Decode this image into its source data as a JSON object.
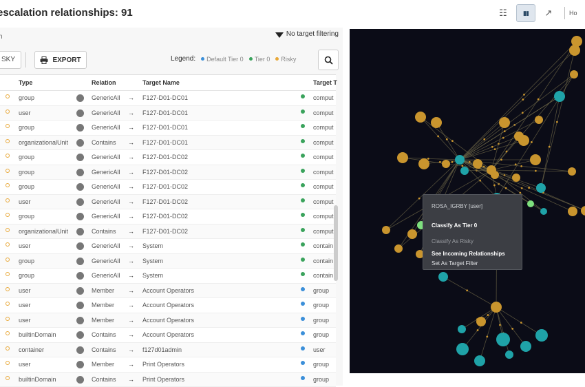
{
  "header": {
    "title": "escalation relationships: 91",
    "view_buttons": [
      {
        "icon": "list-view-icon",
        "glyph": "☷"
      },
      {
        "icon": "split-view-icon",
        "glyph": "▮▮"
      },
      {
        "icon": "graph-view-icon",
        "glyph": "↗"
      }
    ],
    "cut_label": "Ho"
  },
  "panel": {
    "subtitle": "n",
    "filter_label": "No target filtering"
  },
  "toolbar": {
    "risky_label": "SKY",
    "export_label": "EXPORT",
    "legend_label": "Legend:",
    "legend": [
      {
        "label": "Default Tier 0",
        "color": "#3b8fd9"
      },
      {
        "label": "Tier 0",
        "color": "#3aa35c"
      },
      {
        "label": "Risky",
        "color": "#e8a838"
      }
    ]
  },
  "table": {
    "columns": [
      "Type",
      "Relation",
      "Target Name",
      "Target T"
    ],
    "rows": [
      {
        "type": "group",
        "relation": "GenericAll",
        "target": "F127-D01-DC01",
        "ttype": "comput",
        "tcolor": "#3aa35c"
      },
      {
        "type": "user",
        "relation": "GenericAll",
        "target": "F127-D01-DC01",
        "ttype": "comput",
        "tcolor": "#3aa35c"
      },
      {
        "type": "group",
        "relation": "GenericAll",
        "target": "F127-D01-DC01",
        "ttype": "comput",
        "tcolor": "#3aa35c"
      },
      {
        "type": "organizationalUnit",
        "relation": "Contains",
        "target": "F127-D01-DC01",
        "ttype": "comput",
        "tcolor": "#3aa35c"
      },
      {
        "type": "group",
        "relation": "GenericAll",
        "target": "F127-D01-DC02",
        "ttype": "comput",
        "tcolor": "#3aa35c"
      },
      {
        "type": "group",
        "relation": "GenericAll",
        "target": "F127-D01-DC02",
        "ttype": "comput",
        "tcolor": "#3aa35c"
      },
      {
        "type": "group",
        "relation": "GenericAll",
        "target": "F127-D01-DC02",
        "ttype": "comput",
        "tcolor": "#3aa35c"
      },
      {
        "type": "user",
        "relation": "GenericAll",
        "target": "F127-D01-DC02",
        "ttype": "comput",
        "tcolor": "#3aa35c"
      },
      {
        "type": "group",
        "relation": "GenericAll",
        "target": "F127-D01-DC02",
        "ttype": "comput",
        "tcolor": "#3aa35c"
      },
      {
        "type": "organizationalUnit",
        "relation": "Contains",
        "target": "F127-D01-DC02",
        "ttype": "comput",
        "tcolor": "#3aa35c"
      },
      {
        "type": "user",
        "relation": "GenericAll",
        "target": "System",
        "ttype": "contain",
        "tcolor": "#3aa35c"
      },
      {
        "type": "group",
        "relation": "GenericAll",
        "target": "System",
        "ttype": "contain",
        "tcolor": "#3aa35c"
      },
      {
        "type": "group",
        "relation": "GenericAll",
        "target": "System",
        "ttype": "contain",
        "tcolor": "#3aa35c"
      },
      {
        "type": "user",
        "relation": "Member",
        "target": "Account Operators",
        "ttype": "group",
        "tcolor": "#3b8fd9"
      },
      {
        "type": "user",
        "relation": "Member",
        "target": "Account Operators",
        "ttype": "group",
        "tcolor": "#3b8fd9"
      },
      {
        "type": "user",
        "relation": "Member",
        "target": "Account Operators",
        "ttype": "group",
        "tcolor": "#3b8fd9"
      },
      {
        "type": "builtinDomain",
        "relation": "Contains",
        "target": "Account Operators",
        "ttype": "group",
        "tcolor": "#3b8fd9"
      },
      {
        "type": "container",
        "relation": "Contains",
        "target": "f127d01admin",
        "ttype": "user",
        "tcolor": "#3b8fd9"
      },
      {
        "type": "user",
        "relation": "Member",
        "target": "Print Operators",
        "ttype": "group",
        "tcolor": "#3b8fd9"
      },
      {
        "type": "builtinDomain",
        "relation": "Contains",
        "target": "Print Operators",
        "ttype": "group",
        "tcolor": "#3b8fd9"
      }
    ]
  },
  "context_menu": {
    "header": "ROSA_IGRBY [user]",
    "items": [
      {
        "label": "Classify As Tier 0",
        "style": "bold"
      },
      {
        "label": "Classify As Risky",
        "style": "dim"
      },
      {
        "label": "See Incoming Relationships",
        "style": "bold"
      },
      {
        "label": "Set As Target Filter",
        "style": "normal"
      }
    ]
  },
  "graph": {
    "background": "#0b0c17",
    "node_colors": {
      "risky": "#c9952e",
      "tier0": "#1fa3a8",
      "highlight": "#7ee07e"
    }
  }
}
